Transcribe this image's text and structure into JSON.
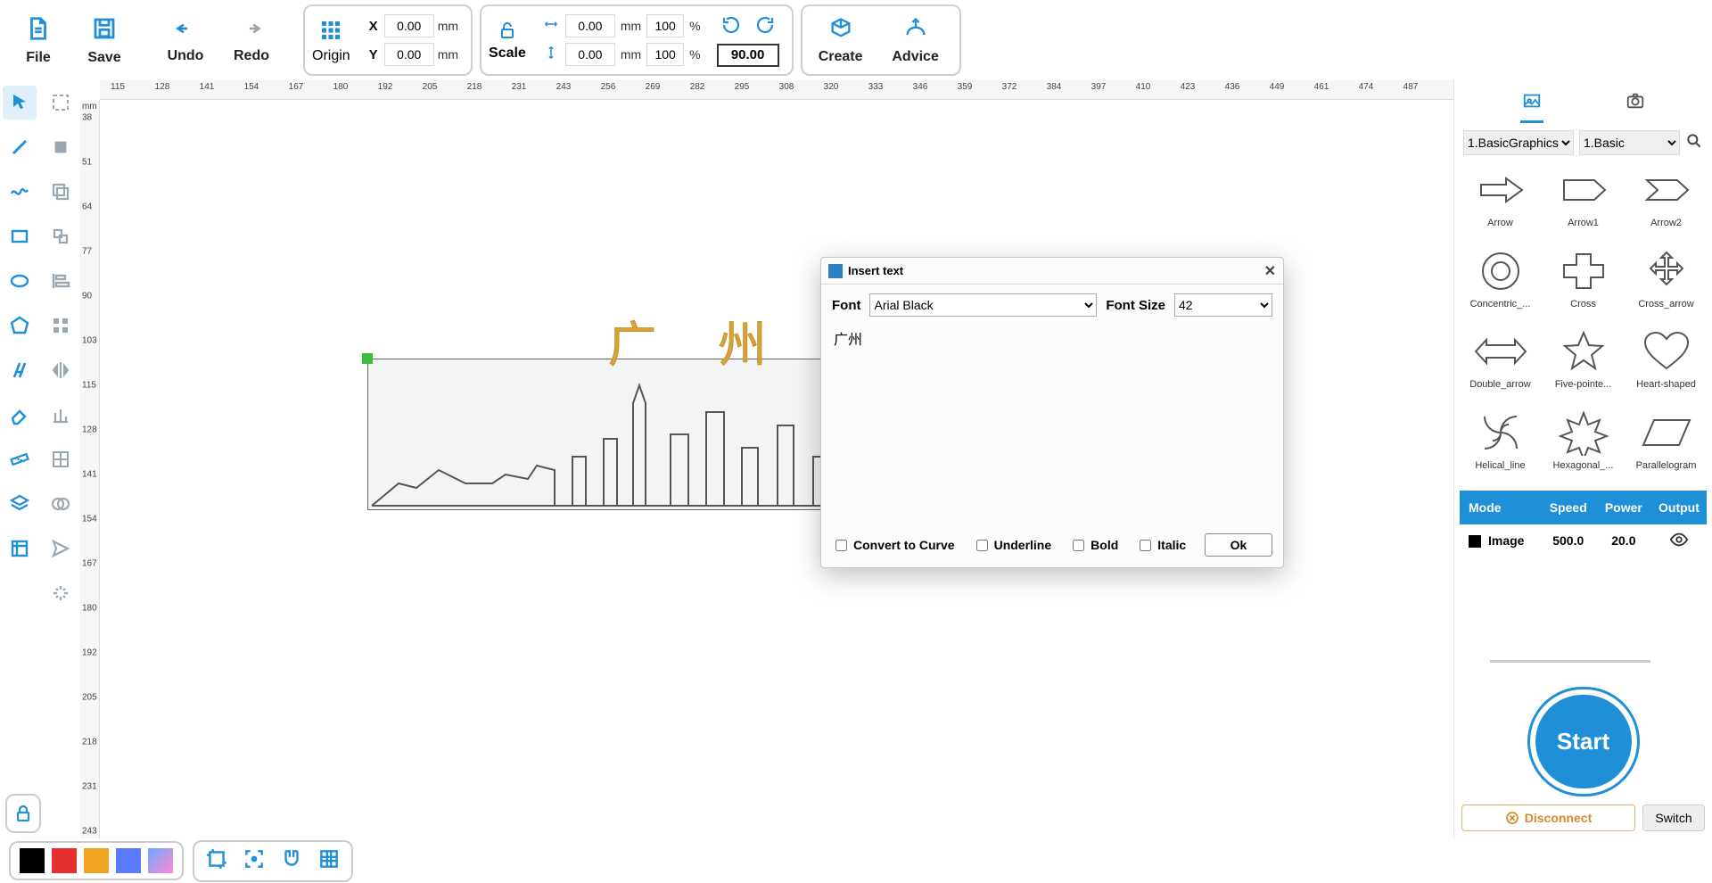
{
  "toolbar": {
    "file": "File",
    "save": "Save",
    "undo": "Undo",
    "redo": "Redo",
    "origin": "Origin",
    "scale": "Scale",
    "create": "Create",
    "advice": "Advice",
    "x_label": "X",
    "y_label": "Y",
    "x_val": "0.00",
    "y_val": "0.00",
    "mm": "mm",
    "w_val": "0.00",
    "h_val": "0.00",
    "w_pct": "100",
    "h_pct": "100",
    "pct": "%",
    "rot_val": "90.00"
  },
  "ruler": {
    "mm": "mm",
    "h_ticks": [
      "115",
      "128",
      "141",
      "154",
      "167",
      "180",
      "192",
      "205",
      "218",
      "231",
      "243",
      "256",
      "269",
      "282",
      "295",
      "308",
      "320",
      "333",
      "346",
      "359",
      "372",
      "384",
      "397",
      "410",
      "423",
      "436",
      "449",
      "461",
      "474",
      "487"
    ],
    "v_ticks": [
      "38",
      "51",
      "64",
      "77",
      "90",
      "103",
      "115",
      "128",
      "141",
      "154",
      "167",
      "180",
      "192",
      "205",
      "218",
      "231",
      "243"
    ]
  },
  "canvas": {
    "text_art": "广 州"
  },
  "dialog": {
    "title": "Insert text",
    "font_label": "Font",
    "font_value": "Arial Black",
    "size_label": "Font Size",
    "size_value": "42",
    "text_value": "广州",
    "convert": "Convert to Curve",
    "underline": "Underline",
    "bold": "Bold",
    "italic": "Italic",
    "ok": "Ok"
  },
  "right": {
    "cat1": "1.BasicGraphics",
    "cat2": "1.Basic",
    "shapes": [
      "Arrow",
      "Arrow1",
      "Arrow2",
      "Concentric_...",
      "Cross",
      "Cross_arrow",
      "Double_arrow",
      "Five-pointe...",
      "Heart-shaped",
      "Helical_line",
      "Hexagonal_...",
      "Parallelogram"
    ],
    "layers": {
      "mode": "Mode",
      "speed": "Speed",
      "power": "Power",
      "output": "Output",
      "row_mode": "Image",
      "row_speed": "500.0",
      "row_power": "20.0"
    },
    "start": "Start",
    "disconnect": "Disconnect",
    "switch": "Switch"
  },
  "swatches": [
    "#000000",
    "#e62e2e",
    "#efa51f",
    "#5a7gff",
    "#ff8bd4"
  ]
}
